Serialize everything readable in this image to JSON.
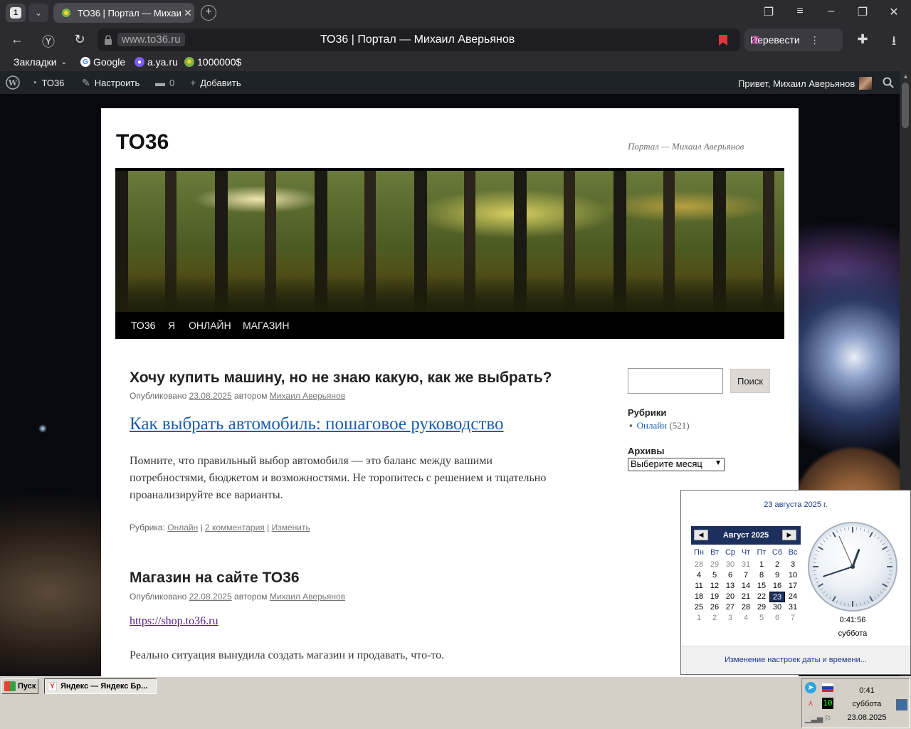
{
  "browser": {
    "tab_count": "1",
    "tab_title": "ТО36 | Портал — Михаил Аверьянов",
    "url": "www.to36.ru",
    "page_title": "ТО36 | Портал — Михаил Аверьянов",
    "translate_label": "Перевести",
    "bookmarks": [
      {
        "label": "Закладки"
      },
      {
        "label": "Google"
      },
      {
        "label": "a.ya.ru"
      },
      {
        "label": "1000000$"
      }
    ]
  },
  "wp_admin_bar": {
    "site": "ТО36",
    "customize": "Настроить",
    "comments_count": "0",
    "add_new": "Добавить",
    "greeting": "Привет, Михаил Аверьянов"
  },
  "site": {
    "title": "ТО36",
    "description": "Портал — Михаил Аверьянов",
    "nav": [
      "ТО36",
      "Я",
      "ОНЛАЙН",
      "МАГАЗИН"
    ],
    "posts": [
      {
        "title": "Хочу купить машину, но не знаю какую, как же выбрать?",
        "meta_prefix": "Опубликовано",
        "date": "23.08.2025",
        "meta_by": "автором",
        "author": "Михаил Аверьянов",
        "link_text": "Как выбрать автомобиль: пошаговое руководство",
        "paragraph": "Помните, что правильный выбор автомобиля — это баланс между вашими потребностями, бюджетом и возможностями. Не торопитесь с решением и тщательно проанализируйте все варианты.",
        "footer_prefix": "Рубрика:",
        "category": "Онлайн",
        "comments": "2 комментария",
        "edit": "Изменить"
      },
      {
        "title": "Магазин на сайте ТО36",
        "meta_prefix": "Опубликовано",
        "date": "22.08.2025",
        "meta_by": "автором",
        "author": "Михаил Аверьянов",
        "link_text": "https://shop.to36.ru",
        "paragraph": "Реально ситуация вынудила создать магазин и продавать, что-то."
      }
    ],
    "sidebar": {
      "search_button": "Поиск",
      "categories_heading": "Рубрики",
      "category_name": "Онлайн",
      "category_count": "(521)",
      "archives_heading": "Архивы",
      "archives_select": "Выберите месяц"
    }
  },
  "calendar": {
    "full_date": "23 августа 2025 г.",
    "month_label": "Август 2025",
    "weekdays": [
      "Пн",
      "Вт",
      "Ср",
      "Чт",
      "Пт",
      "Сб",
      "Вс"
    ],
    "weeks": [
      [
        "28",
        "29",
        "30",
        "31",
        "1",
        "2",
        "3"
      ],
      [
        "4",
        "5",
        "6",
        "7",
        "8",
        "9",
        "10"
      ],
      [
        "11",
        "12",
        "13",
        "14",
        "15",
        "16",
        "17"
      ],
      [
        "18",
        "19",
        "20",
        "21",
        "22",
        "23",
        "24"
      ],
      [
        "25",
        "26",
        "27",
        "28",
        "29",
        "30",
        "31"
      ],
      [
        "1",
        "2",
        "3",
        "4",
        "5",
        "6",
        "7"
      ]
    ],
    "selected_day": "23",
    "time": "0:41:56",
    "weekday": "суббота",
    "settings_link": "Изменение настроек даты и времени..."
  },
  "taskbar": {
    "start": "Пуск",
    "window": "Яндекс — Яндекс Бр...",
    "clock_time": "0:41",
    "clock_day": "суббота",
    "clock_date": "23.08.2025",
    "tray_number": "10"
  },
  "colors": {
    "link": "#1b5dad",
    "visited_link": "#551a8b",
    "wp_bar": "#1d2327",
    "calendar_accent": "#1d2f5c"
  }
}
